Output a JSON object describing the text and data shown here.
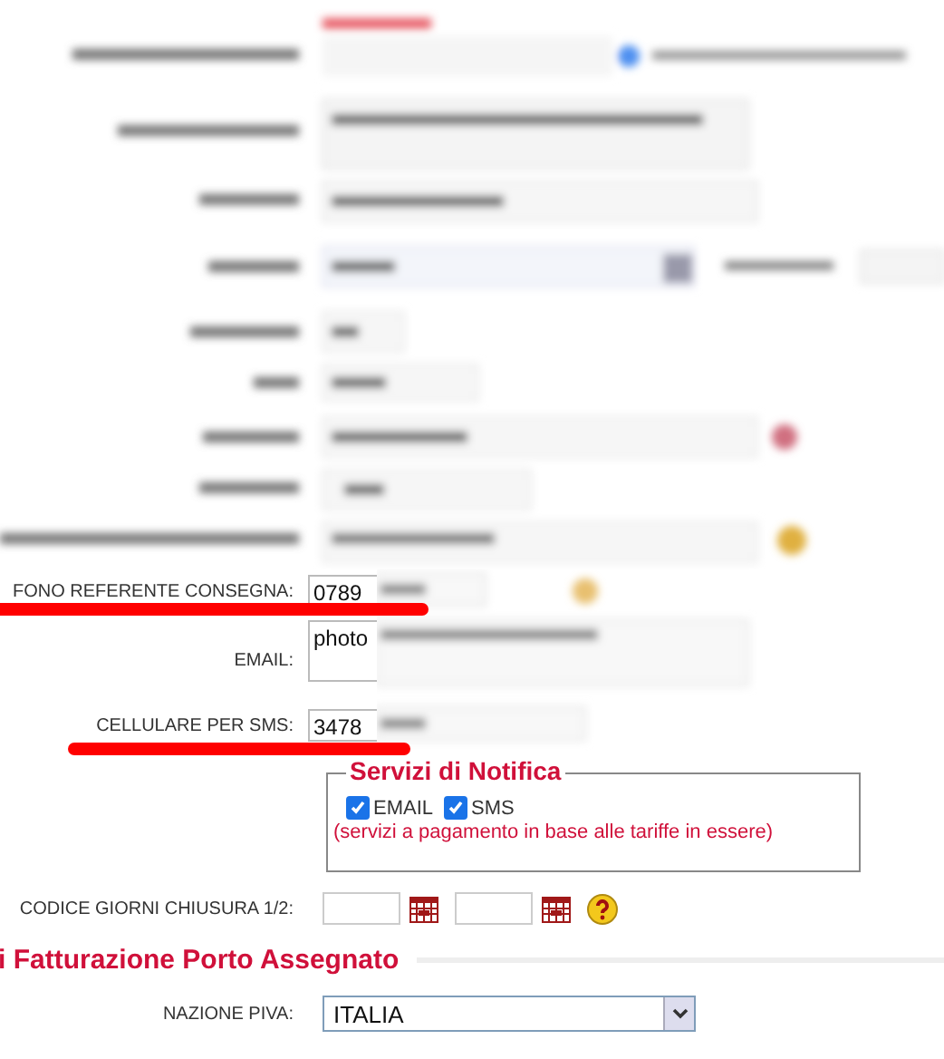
{
  "contact_rows": [
    {
      "label": "FONO REFERENTE CONSEGNA:",
      "value": "0789",
      "kind": "input"
    },
    {
      "label": "EMAIL:",
      "value": "photo",
      "kind": "textarea"
    },
    {
      "label": "CELLULARE PER SMS:",
      "value": "3478",
      "kind": "input"
    }
  ],
  "notification_services": {
    "legend": "Servizi di Notifica",
    "options": [
      {
        "label": "EMAIL",
        "checked": true
      },
      {
        "label": "SMS",
        "checked": true
      }
    ],
    "note": "(servizi a pagamento in base alle tariffe in essere)"
  },
  "closing_days": {
    "label": "CODICE GIORNI CHIUSURA 1/2:"
  },
  "section_title": "i Fatturazione Porto Assegnato",
  "vat_country": {
    "label": "NAZIONE PIVA:",
    "value": "ITALIA"
  }
}
